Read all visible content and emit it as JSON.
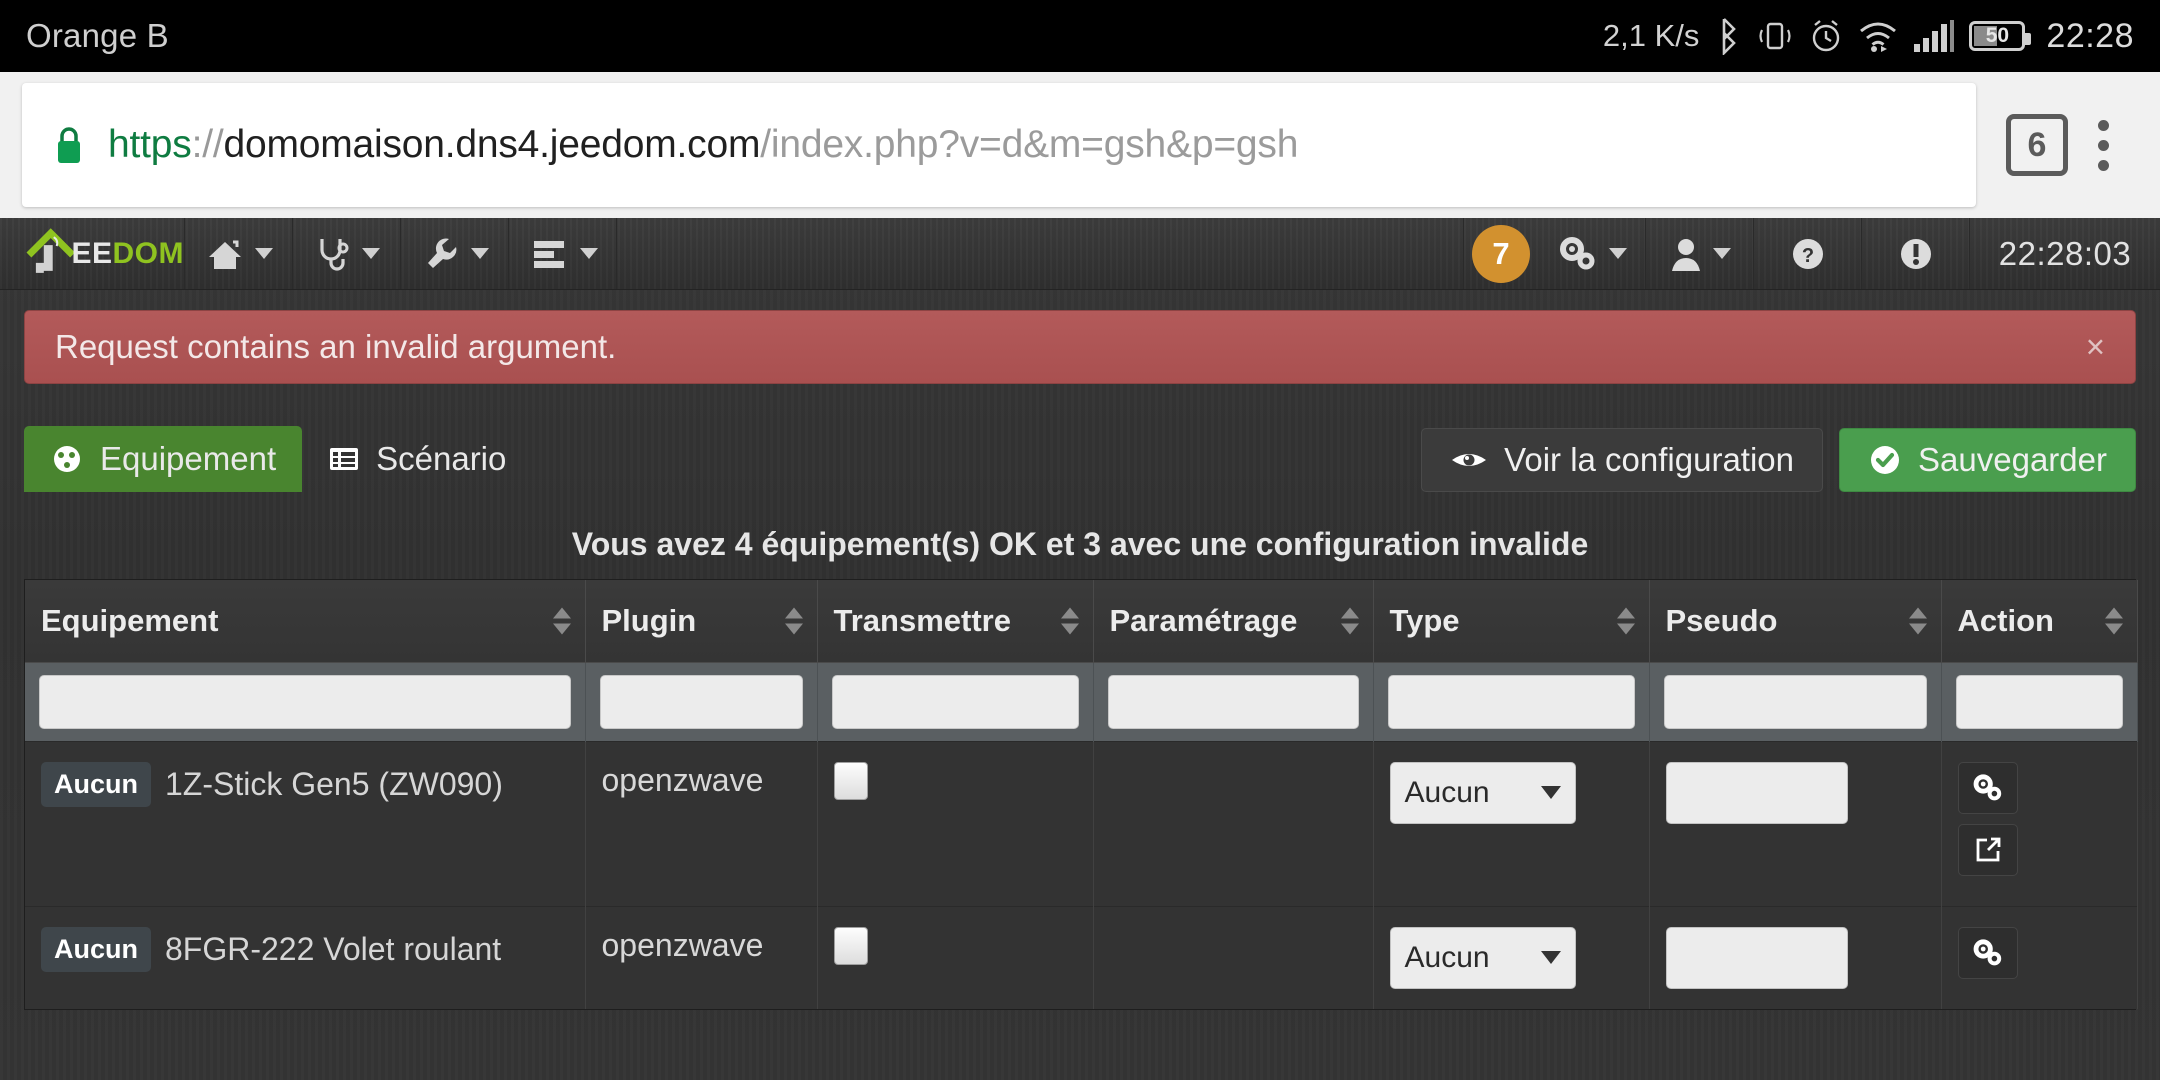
{
  "statusbar": {
    "carrier": "Orange B",
    "network_speed": "2,1 K/s",
    "battery_level": "50",
    "clock": "22:28",
    "icons": [
      "bluetooth-icon",
      "vibrate-icon",
      "alarm-icon",
      "wifi-icon",
      "signal-icon",
      "battery-icon"
    ]
  },
  "browser": {
    "lock_icon": "lock-icon",
    "url_scheme": "https",
    "url_separator": "://",
    "url_host": "domomaison.dns4.jeedom.com",
    "url_path": "/index.php?v=d&m=gsh&p=gsh",
    "tab_count": "6",
    "menu_icon": "kebab-menu-icon"
  },
  "navbar": {
    "brand_first": "EE",
    "brand_second": "DOM",
    "items": [
      {
        "icon": "home-icon",
        "label": ""
      },
      {
        "icon": "stethoscope-icon",
        "label": ""
      },
      {
        "icon": "wrench-icon",
        "label": ""
      },
      {
        "icon": "list-icon",
        "label": ""
      }
    ],
    "badge_count": "7",
    "right_items": [
      {
        "icon": "gears-icon"
      },
      {
        "icon": "user-icon"
      },
      {
        "icon": "help-circle-icon"
      },
      {
        "icon": "warning-circle-icon"
      }
    ],
    "clock": "22:28:03"
  },
  "alert": {
    "message": "Request contains an invalid argument.",
    "close_label": "×"
  },
  "tabs": [
    {
      "label": "Equipement",
      "icon": "dashboard-icon",
      "active": true
    },
    {
      "label": "Scénario",
      "icon": "list-alt-icon",
      "active": false
    }
  ],
  "actions": {
    "view_config": "Voir la configuration",
    "view_config_icon": "eye-icon",
    "save": "Sauvegarder",
    "save_icon": "check-circle-icon"
  },
  "summary": "Vous avez 4 équipement(s) OK et 3 avec une configuration invalide",
  "table": {
    "headers": [
      "Equipement",
      "Plugin",
      "Transmettre",
      "Paramétrage",
      "Type",
      "Pseudo",
      "Action"
    ],
    "filters": [
      "",
      "",
      "",
      "",
      "",
      "",
      ""
    ],
    "rows": [
      {
        "badge": "Aucun",
        "equipement": "1Z-Stick Gen5 (ZW090)",
        "plugin": "openzwave",
        "transmettre_checked": false,
        "parametrage": "",
        "type": "Aucun",
        "pseudo": "",
        "actions": [
          "gears-icon",
          "external-link-icon"
        ]
      },
      {
        "badge": "Aucun",
        "equipement": "8FGR-222 Volet roulant",
        "plugin": "openzwave",
        "transmettre_checked": false,
        "parametrage": "",
        "type": "Aucun",
        "pseudo": "",
        "actions": [
          "gears-icon"
        ]
      }
    ]
  },
  "colors": {
    "accent_green": "#49852f",
    "save_green": "#4a9e4e",
    "alert_red": "#b35a5a",
    "badge_orange": "#d2912f",
    "brand_green": "#8fc320"
  }
}
